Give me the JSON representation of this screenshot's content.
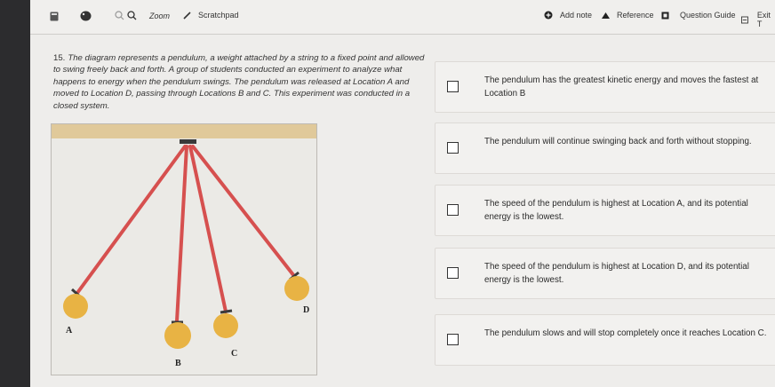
{
  "toolbar": {
    "zoom_label": "Zoom",
    "scratchpad_label": "Scratchpad",
    "add_note_label": "Add note",
    "reference_label": "Reference",
    "question_guide_label": "Question Guide",
    "exit_label": "Exit T"
  },
  "question": {
    "number": "15.",
    "text": "The diagram represents a pendulum, a weight attached by a string to a fixed point and allowed to swing freely back and forth. A group of students conducted an experiment to analyze what happens to energy when the pendulum swings. The pendulum was released at Location A and moved to Location D, passing through Locations B and C. This experiment was conducted in a closed system."
  },
  "diagram": {
    "labels": {
      "a": "A",
      "b": "B",
      "c": "C",
      "d": "D"
    },
    "colors": {
      "top_bar": "#e0c99a",
      "string": "#d6504f",
      "bob": "#e8b344"
    }
  },
  "options": [
    {
      "text": "The pendulum has the greatest kinetic energy and moves the fastest at Location B"
    },
    {
      "text": "The pendulum will continue swinging back and forth without stopping."
    },
    {
      "text": "The speed of the pendulum is highest at Location A, and its potential energy is the lowest."
    },
    {
      "text": "The speed of the pendulum is highest at Location D, and its potential energy is the lowest."
    },
    {
      "text": "The pendulum slows and will stop completely once it reaches Location C."
    }
  ]
}
